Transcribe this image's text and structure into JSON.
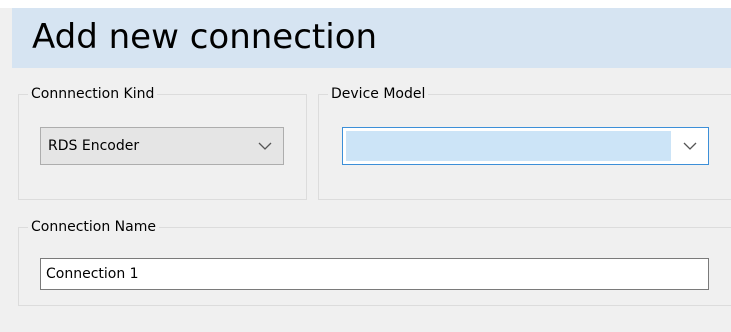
{
  "header": {
    "title": "Add new connection"
  },
  "connection_kind": {
    "legend": "Connnection Kind",
    "selected": "RDS Encoder",
    "dropdown_icon": "chevron-down-icon"
  },
  "device_model": {
    "legend": "Device Model",
    "selected": "",
    "dropdown_icon": "chevron-down-icon"
  },
  "connection_name": {
    "legend": "Connection Name",
    "value": "Connection 1"
  },
  "colors": {
    "header_background": "#d6e4f2",
    "focus_border": "#3c8fd8",
    "focus_fill": "#cce4f7"
  }
}
